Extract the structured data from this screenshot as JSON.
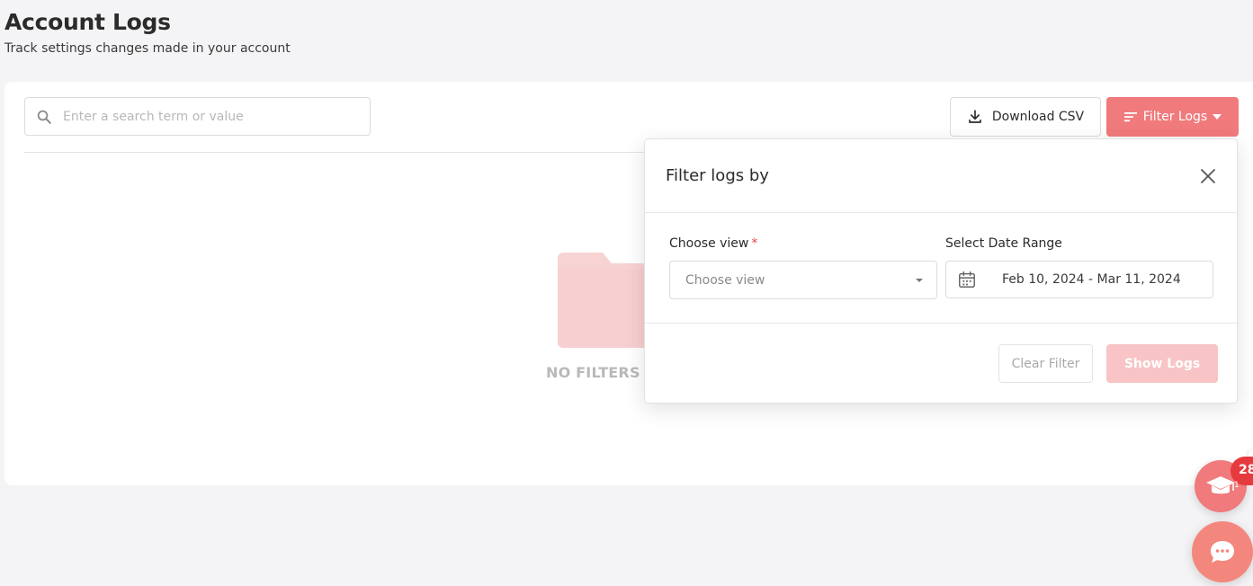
{
  "header": {
    "title": "Account Logs",
    "subtitle": "Track settings changes made in your account"
  },
  "search": {
    "placeholder": "Enter a search term or value",
    "value": ""
  },
  "toolbar": {
    "download_label": "Download CSV",
    "filter_label": "Filter Logs"
  },
  "empty_state": {
    "text": "NO FILTERS S"
  },
  "filter_popover": {
    "title": "Filter logs by",
    "view_label": "Choose view",
    "view_required_mark": "*",
    "view_placeholder": "Choose view",
    "date_label": "Select Date Range",
    "date_value": "Feb 10, 2024 - Mar 11, 2024",
    "clear_label": "Clear Filter",
    "show_label": "Show Logs"
  },
  "widgets": {
    "learn_badge_count": "28",
    "learn_badge_sub": "1"
  },
  "colors": {
    "accent": "#f07a7c",
    "accent_light": "#f8c4c5",
    "badge": "#e63b3e",
    "required": "#e5484d"
  }
}
